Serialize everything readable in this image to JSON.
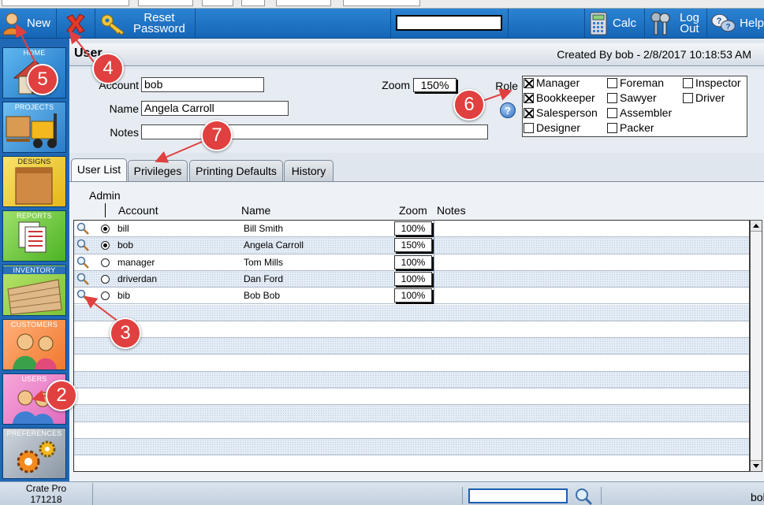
{
  "toolbar": {
    "new_label": "New",
    "reset_label_1": "Reset",
    "reset_label_2": "Password",
    "calc_label": "Calc",
    "logout_label_1": "Log",
    "logout_label_2": "Out",
    "help_label": "Help",
    "search_value": ""
  },
  "nav": {
    "home": "HOME",
    "projects": "PROJECTS",
    "designs": "DESIGNS",
    "reports": "REPORTS",
    "inventory": "INVENTORY",
    "customers": "CUSTOMERS",
    "users": "USERS",
    "preferences": "PREFERENCES"
  },
  "header": {
    "title": "User",
    "created": "Created By bob  -  2/8/2017 10:18:53 AM"
  },
  "form": {
    "account_label": "Account",
    "account_value": "bob",
    "name_label": "Name",
    "name_value": "Angela Carroll",
    "notes_label": "Notes",
    "notes_value": "",
    "zoom_label": "Zoom",
    "zoom_value": "150%",
    "role_label": "Role",
    "help_glyph": "?"
  },
  "roles": [
    {
      "label": "Manager",
      "checked": true
    },
    {
      "label": "Foreman",
      "checked": false
    },
    {
      "label": "Inspector",
      "checked": false
    },
    {
      "label": "Bookkeeper",
      "checked": true
    },
    {
      "label": "Sawyer",
      "checked": false
    },
    {
      "label": "Driver",
      "checked": false
    },
    {
      "label": "Salesperson",
      "checked": true
    },
    {
      "label": "Assembler",
      "checked": false
    },
    {
      "label": "Designer",
      "checked": false
    },
    {
      "label": "Packer",
      "checked": false
    }
  ],
  "tabs": [
    "User List",
    "Privileges",
    "Printing Defaults",
    "History"
  ],
  "list": {
    "admin_header": "Admin",
    "headers": {
      "account": "Account",
      "name": "Name",
      "zoom": "Zoom",
      "notes": "Notes"
    },
    "rows": [
      {
        "account": "bill",
        "name": "Bill Smith",
        "zoom": "100%",
        "admin": true
      },
      {
        "account": "bob",
        "name": "Angela Carroll",
        "zoom": "150%",
        "admin": true
      },
      {
        "account": "manager",
        "name": "Tom Mills",
        "zoom": "100%",
        "admin": false
      },
      {
        "account": "driverdan",
        "name": "Dan Ford",
        "zoom": "100%",
        "admin": false
      },
      {
        "account": "bib",
        "name": "Bob Bob",
        "zoom": "100%",
        "admin": false
      }
    ]
  },
  "status": {
    "app_name": "Crate Pro",
    "version": "171218",
    "search_value": "",
    "user": "bob"
  },
  "callouts": [
    "2",
    "3",
    "4",
    "5",
    "6",
    "7"
  ],
  "colors": {
    "toolbar": "#1a6fc4",
    "callout": "#e0403f",
    "nav": "#1f68b6"
  }
}
